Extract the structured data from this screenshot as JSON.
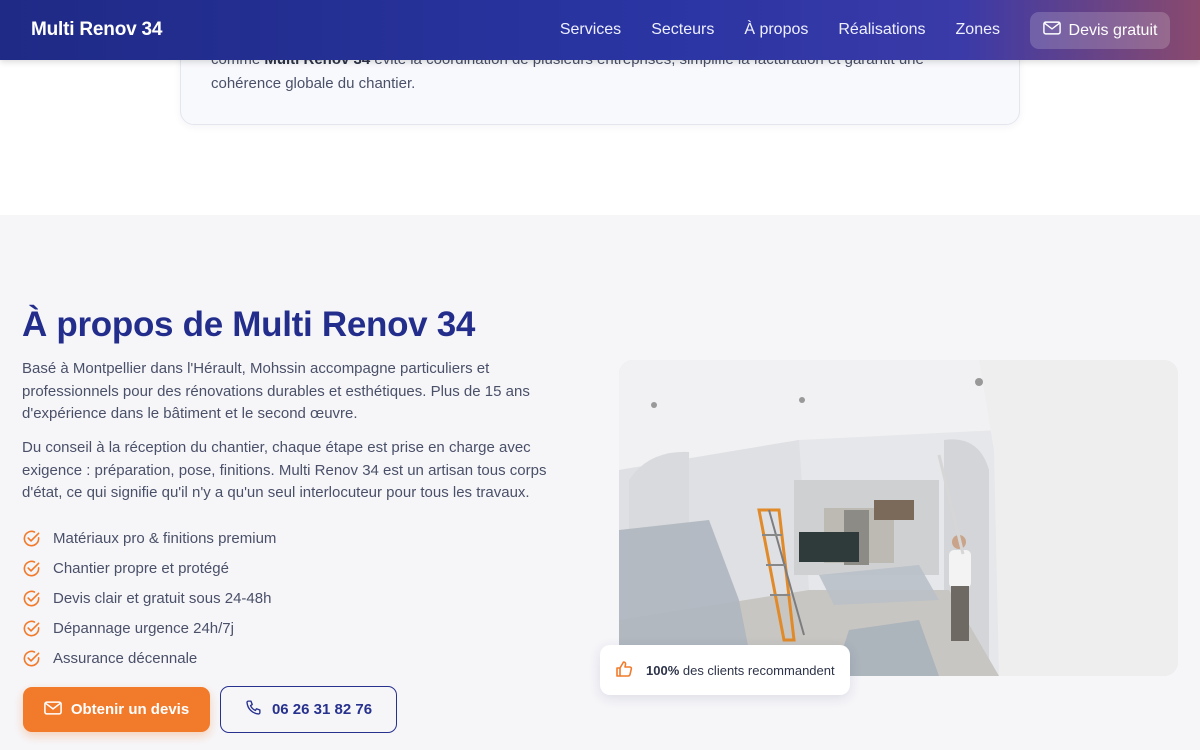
{
  "navbar": {
    "brand": "Multi Renov 34",
    "links": [
      "Services",
      "Secteurs",
      "À propos",
      "Réalisations",
      "Zones"
    ],
    "cta_label": "Devis gratuit"
  },
  "top_card": {
    "line1_start": "comme ",
    "line1_bold": "Multi Renov 34",
    "line1_end": " évite la coordination de plusieurs entreprises, simplifie la facturation et garantit une",
    "line2": "cohérence globale du chantier."
  },
  "about": {
    "title": "À propos de Multi Renov 34",
    "paragraph1": "Basé à Montpellier dans l'Hérault, Mohssin accompagne particuliers et professionnels pour des rénovations durables et esthétiques. Plus de 15 ans d'expérience dans le bâtiment et le second œuvre.",
    "paragraph2": "Du conseil à la réception du chantier, chaque étape est prise en charge avec exigence : préparation, pose, finitions. Multi Renov 34 est un artisan tous corps d'état, ce qui signifie qu'il n'y a qu'un seul interlocuteur pour tous les travaux.",
    "checklist": [
      "Matériaux pro & finitions premium",
      "Chantier propre et protégé",
      "Devis clair et gratuit sous 24-48h",
      "Dépannage urgence 24h/7j",
      "Assurance décennale"
    ],
    "quote_button": "Obtenir un devis",
    "phone_button": "06 26 31 82 76",
    "badge_value": "100%",
    "badge_text": " des clients recommandent"
  },
  "colors": {
    "primary": "#232e8c",
    "accent": "#f17a2b",
    "section_bg": "#f6f6f9"
  },
  "icons": [
    "mail-icon",
    "check-circle-icon",
    "phone-icon",
    "thumbs-up-icon"
  ]
}
